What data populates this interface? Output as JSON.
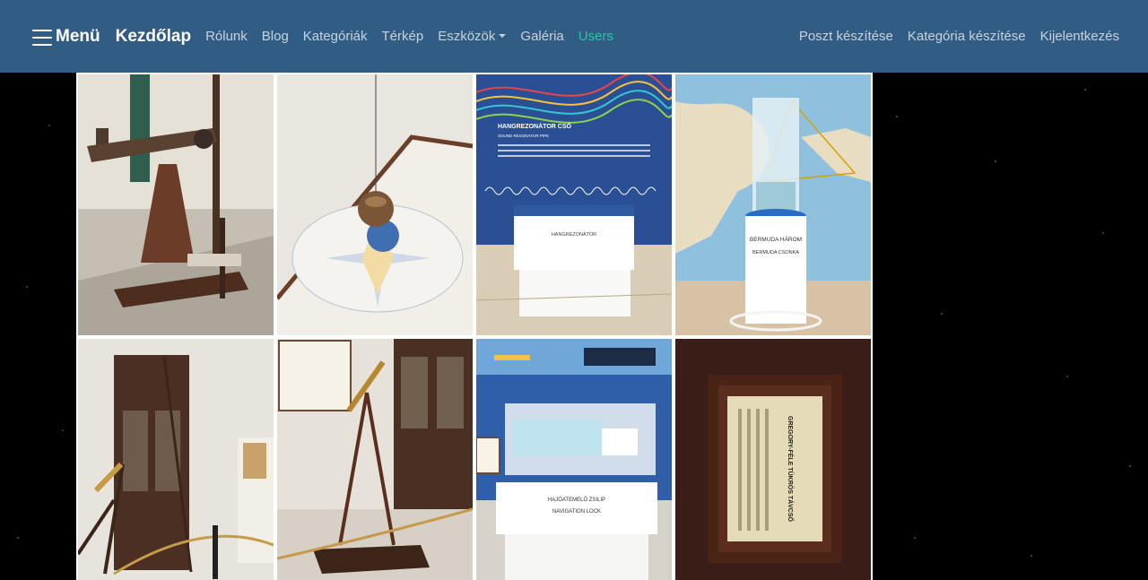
{
  "navbar": {
    "menu_label": "Menü",
    "brand": "Kezdőlap",
    "links": [
      "Rólunk",
      "Blog",
      "Kategóriák",
      "Térkép",
      "Eszközök",
      "Galéria",
      "Users"
    ],
    "right_links": [
      "Poszt készítése",
      "Kategória készítése",
      "Kijelentkezés"
    ],
    "colors": {
      "background": "#315c84",
      "active": "#2ec4a3"
    }
  },
  "gallery": {
    "photos": [
      {
        "icon": "telescope-photo"
      },
      {
        "icon": "pendulum-photo"
      },
      {
        "icon": "sound-resonator-photo",
        "title": "HANGREZONÁTOR CSŐ",
        "subtitle": "SOUND RESONATOR PIPE",
        "label": "HANGREZONÁTOR"
      },
      {
        "icon": "bermuda-triangle-photo",
        "label1": "BERMUDA HÁROM",
        "label2": "BERMUDA CSONKA"
      },
      {
        "icon": "brass-telescope-photo"
      },
      {
        "icon": "tripod-telescope-photo"
      },
      {
        "icon": "navigation-lock-photo",
        "label1": "HAJÓATEMELŐ ZSILIP",
        "label2": "NAVIGATION LOCK"
      },
      {
        "icon": "framed-sign-photo",
        "title": "GREGORY-FÉLE TÜKRÖS TÁVCSŐ"
      }
    ]
  }
}
